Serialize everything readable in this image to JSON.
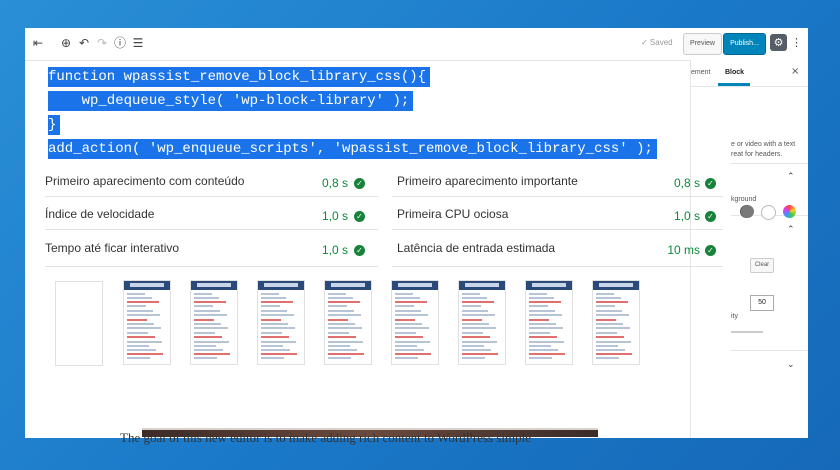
{
  "toolbar": {
    "icons": [
      "sidebar-toggle-icon",
      "add-block-icon",
      "undo-icon",
      "redo-icon",
      "info-icon",
      "outline-icon"
    ],
    "saved_label": "✓ Saved",
    "preview_label": "Preview",
    "publish_label": "Publish...",
    "settings_icon": "gear-icon",
    "more_icon": "more-vertical-icon"
  },
  "sidebar": {
    "tab_document": "ement",
    "tab_block": "Block",
    "close_glyph": "×",
    "description": "e or video with a text reat for headers.",
    "background_label": "kground",
    "clear_label": "Clear",
    "slider_label": "ity",
    "slider_value": "50",
    "swatch_colors": [
      "#555555",
      "#7a7a7a",
      "#ffffff",
      "#ff9900"
    ]
  },
  "code": {
    "lines": [
      "function wpassist_remove_block_library_css(){",
      "    wp_dequeue_style( 'wp-block-library' );",
      "}",
      "add_action( 'wp_enqueue_scripts', 'wpassist_remove_block_library_css' );"
    ],
    "highlight_color": "#1a73e8"
  },
  "metrics": [
    {
      "label": "Primeiro aparecimento com conteúdo",
      "value": "0,8 s"
    },
    {
      "label": "Primeiro aparecimento importante",
      "value": "0,8 s"
    },
    {
      "label": "Índice de velocidade",
      "value": "1,0 s"
    },
    {
      "label": "Primeira CPU ociosa",
      "value": "1,0 s"
    },
    {
      "label": "Tempo até ficar interativo",
      "value": "1,0 s"
    },
    {
      "label": "Latência de entrada estimada",
      "value": "10 ms"
    }
  ],
  "metric_color": "#0a8a3c",
  "filmstrip_count": 9,
  "content": {
    "paragraph": "The goal of this new editor is to make adding rich content to WordPress simple"
  }
}
